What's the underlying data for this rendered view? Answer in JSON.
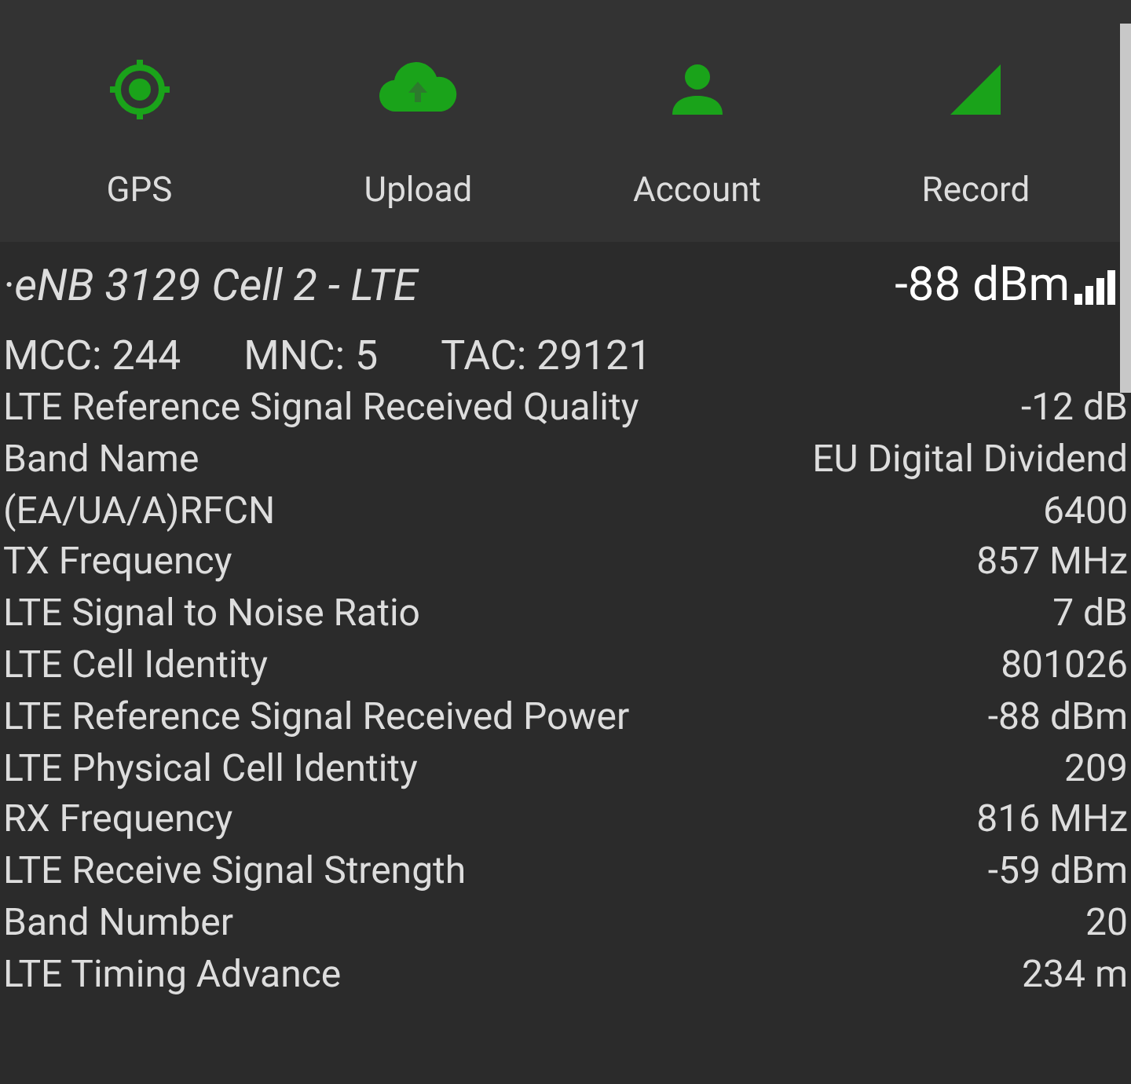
{
  "actions": [
    {
      "kind": "gps",
      "label": "GPS"
    },
    {
      "kind": "upload",
      "label": "Upload"
    },
    {
      "kind": "account",
      "label": "Account"
    },
    {
      "kind": "record",
      "label": "Record"
    }
  ],
  "cell": {
    "title": "·eNB 3129 Cell 2 - LTE",
    "signal": "-88 dBm",
    "codes": [
      "MCC: 244",
      "MNC: 5",
      "TAC: 29121"
    ]
  },
  "rows": [
    {
      "label": "LTE Reference Signal Received Quality",
      "value": "-12 dB"
    },
    {
      "label": "Band Name",
      "value": "EU Digital Dividend"
    },
    {
      "label": "(EA/UA/A)RFCN",
      "value": "6400"
    },
    {
      "label": "TX Frequency",
      "value": "857 MHz"
    },
    {
      "label": "LTE Signal to Noise Ratio",
      "value": "7 dB"
    },
    {
      "label": "LTE Cell Identity",
      "value": "801026"
    },
    {
      "label": "LTE Reference Signal Received Power",
      "value": "-88 dBm"
    },
    {
      "label": "LTE Physical Cell Identity",
      "value": "209"
    },
    {
      "label": "RX Frequency",
      "value": "816 MHz"
    },
    {
      "label": "LTE Receive Signal Strength",
      "value": "-59 dBm"
    },
    {
      "label": "Band Number",
      "value": "20"
    },
    {
      "label": "LTE Timing Advance",
      "value": "234 m"
    }
  ]
}
